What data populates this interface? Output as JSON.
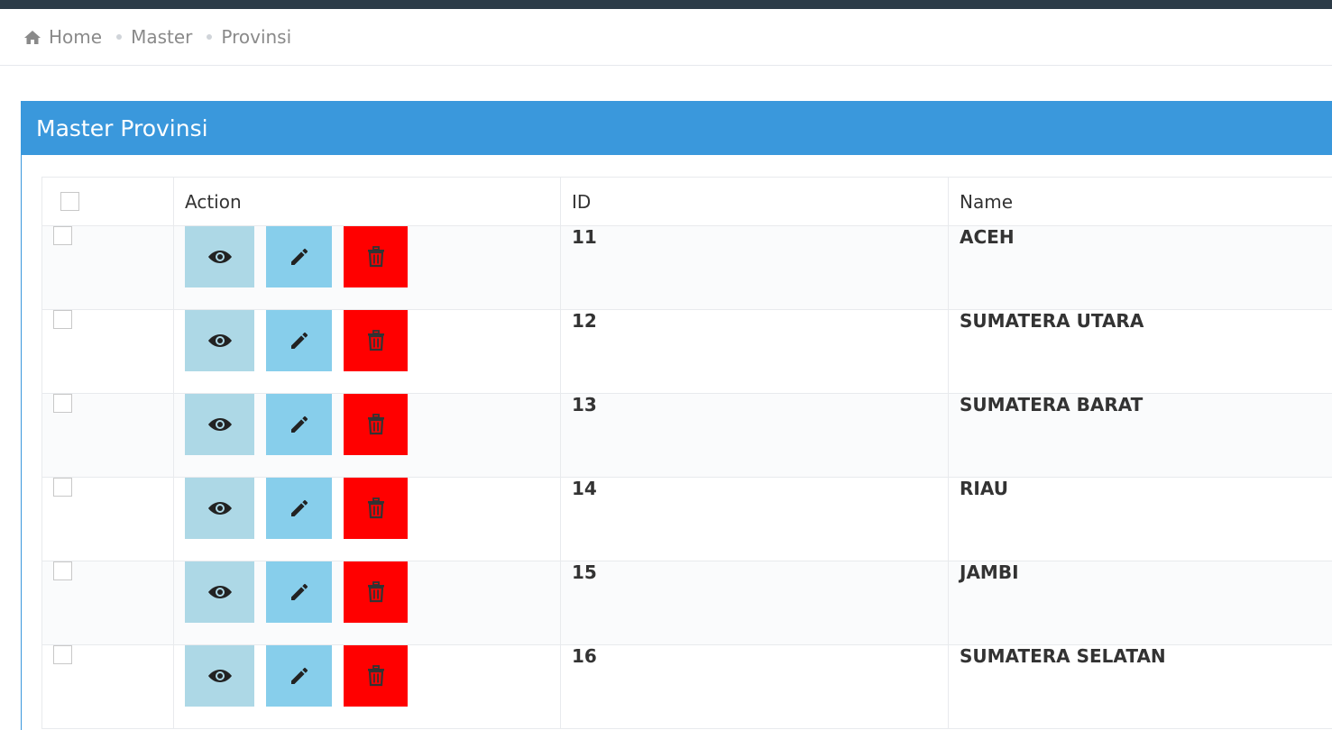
{
  "breadcrumb": {
    "home_icon": "home-icon",
    "items": [
      "Home",
      "Master",
      "Provinsi"
    ]
  },
  "panel": {
    "title": "Master Provinsi"
  },
  "table": {
    "columns": {
      "action": "Action",
      "id": "ID",
      "name": "Name"
    },
    "rows": [
      {
        "id": "11",
        "name": "ACEH"
      },
      {
        "id": "12",
        "name": "SUMATERA UTARA"
      },
      {
        "id": "13",
        "name": "SUMATERA BARAT"
      },
      {
        "id": "14",
        "name": "RIAU"
      },
      {
        "id": "15",
        "name": "JAMBI"
      },
      {
        "id": "16",
        "name": "SUMATERA SELATAN"
      }
    ],
    "actions": {
      "view": "eye-icon",
      "edit": "pencil-icon",
      "delete": "trash-icon"
    }
  },
  "colors": {
    "header": "#3a98dc",
    "view_button": "#add8e6",
    "edit_button": "#87ceeb",
    "delete_button": "#ff0000",
    "topbar": "#2c3b47"
  }
}
